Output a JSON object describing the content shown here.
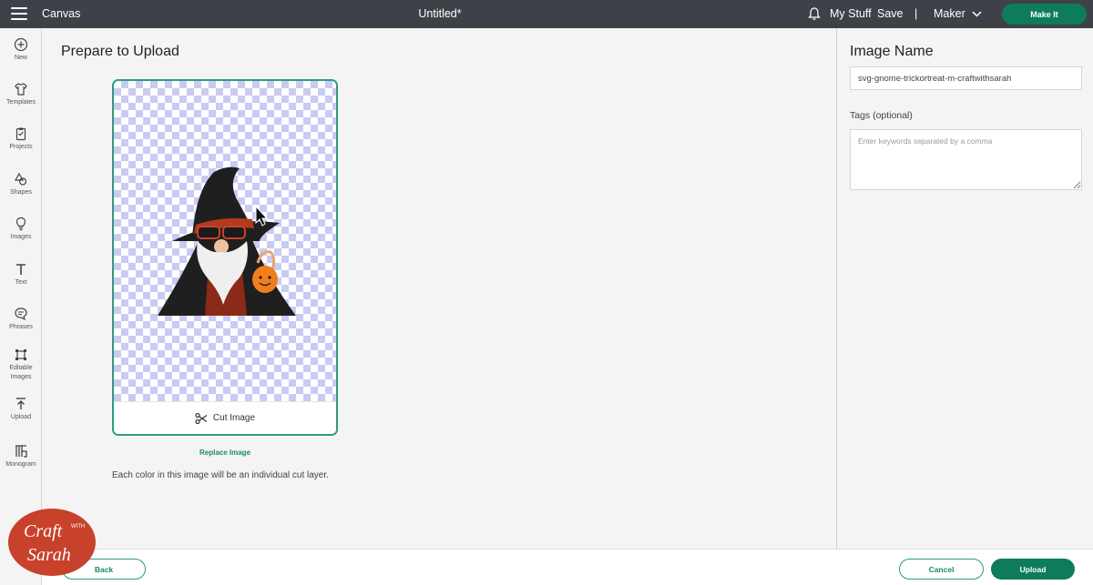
{
  "topbar": {
    "app_title": "Canvas",
    "doc_title": "Untitled*",
    "my_stuff": "My Stuff",
    "save": "Save",
    "separator": "|",
    "machine": "Maker",
    "make_it": "Make It"
  },
  "sidebar": {
    "items": [
      {
        "label": "New",
        "icon": "plus-circle-icon"
      },
      {
        "label": "Templates",
        "icon": "shirt-icon"
      },
      {
        "label": "Projects",
        "icon": "clipboard-icon"
      },
      {
        "label": "Shapes",
        "icon": "shapes-icon"
      },
      {
        "label": "Images",
        "icon": "lightbulb-icon"
      },
      {
        "label": "Text",
        "icon": "text-icon"
      },
      {
        "label": "Phrases",
        "icon": "speech-bubble-icon"
      },
      {
        "label": "Editable Images",
        "icon": "editable-image-icon"
      },
      {
        "label": "Upload",
        "icon": "upload-icon"
      },
      {
        "label": "Monogram",
        "icon": "monogram-icon"
      }
    ]
  },
  "main": {
    "title": "Prepare to Upload",
    "cut_image_label": "Cut Image",
    "replace_image": "Replace Image",
    "note": "Each color in this image will be an individual cut layer."
  },
  "right_panel": {
    "title": "Image Name",
    "image_name_value": "svg-gnome-trickortreat-m-craftwithsarah",
    "tags_label": "Tags (optional)",
    "tags_placeholder": "Enter keywords separated by a comma"
  },
  "bottom": {
    "back": "Back",
    "cancel": "Cancel",
    "upload": "Upload"
  },
  "watermark": {
    "line1": "Craft",
    "with": "WITH",
    "line2": "Sarah"
  },
  "colors": {
    "topbar": "#3e4248",
    "accent": "#0e7c5a",
    "accent_border": "#2f9a82",
    "checker": "#c9cbf3",
    "watermark": "#c8412b"
  }
}
